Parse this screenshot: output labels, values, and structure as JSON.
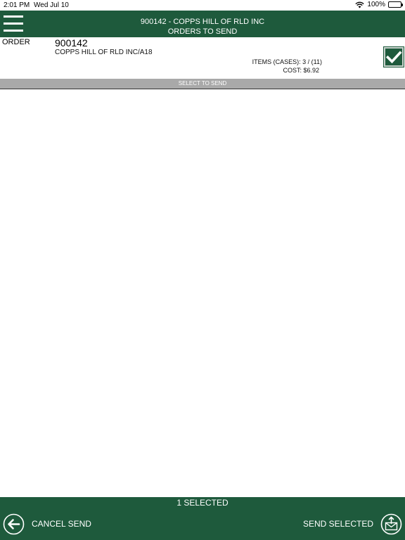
{
  "status_bar": {
    "time": "2:01 PM",
    "date": "Wed Jul 10",
    "battery": "100%"
  },
  "header": {
    "title_line1": "900142 - COPPS HILL OF RLD INC",
    "title_line2": "ORDERS TO SEND"
  },
  "order": {
    "label": "ORDER",
    "number": "900142",
    "customer": "COPPS HILL OF RLD INC/A18",
    "items": "ITEMS (CASES): 3 / (11)",
    "cost": "COST: $6.92",
    "checked": true
  },
  "select_bar": {
    "label": "SELECT TO SEND"
  },
  "footer": {
    "selected_count": "1 SELECTED",
    "cancel_label": "CANCEL SEND",
    "send_label": "SEND SELECTED"
  },
  "colors": {
    "brand_green": "#1e5a3c",
    "bar_gray": "#a9a9a9"
  }
}
